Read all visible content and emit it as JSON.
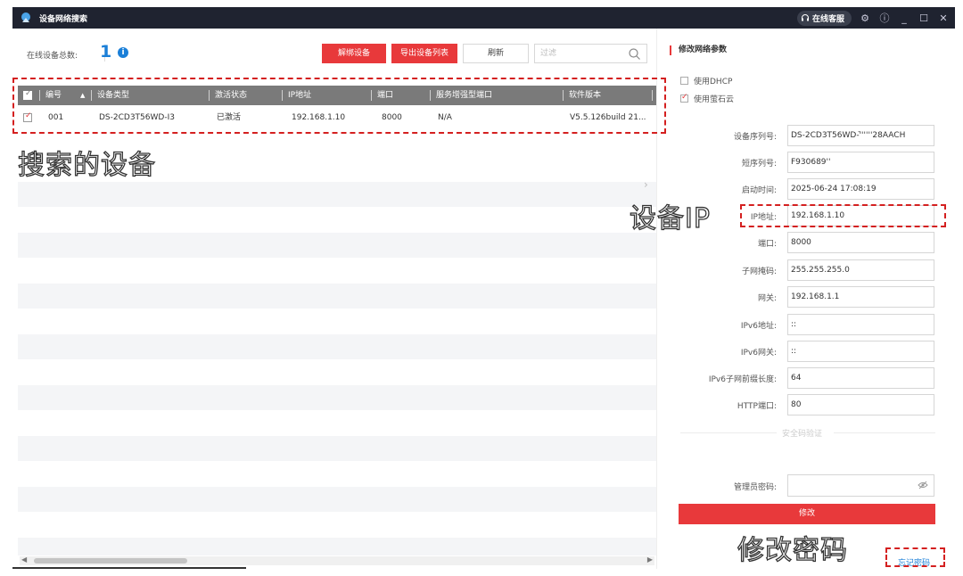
{
  "window": {
    "title": "设备网络搜索",
    "support_label": "在线客服",
    "controls": [
      "settings",
      "info",
      "minimize",
      "maximize",
      "close"
    ]
  },
  "toolbar": {
    "online_label": "在线设备总数:",
    "online_count": "1",
    "unbind_label": "解绑设备",
    "export_label": "导出设备列表",
    "refresh_label": "刷新",
    "filter_placeholder": "过滤"
  },
  "table": {
    "columns": [
      "编号",
      "设备类型",
      "激活状态",
      "IP地址",
      "端口",
      "服务增强型端口",
      "软件版本"
    ],
    "rows": [
      {
        "checked": true,
        "no": "001",
        "device_type": "DS-2CD3T56WD-I3",
        "status": "已激活",
        "ip": "192.168.1.10",
        "port": "8000",
        "enhanced_port": "N/A",
        "version": "V5.5.126build 21..."
      }
    ]
  },
  "panel": {
    "title": "修改网络参数",
    "options": [
      {
        "label": "使用DHCP",
        "checked": false
      },
      {
        "label": "使用萤石云",
        "checked": true
      }
    ],
    "fields": [
      {
        "label": "设备序列号:",
        "value": "DS-2CD3T56WD-'̄'''''28AACH"
      },
      {
        "label": "短序列号:",
        "value": "F930689''"
      },
      {
        "label": "启动时间:",
        "value": "2025-06-24 17:08:19"
      },
      {
        "label": "IP地址:",
        "value": "192.168.1.10"
      },
      {
        "label": "端口:",
        "value": "8000"
      },
      {
        "label": "子网掩码:",
        "value": "255.255.255.0"
      },
      {
        "label": "网关:",
        "value": "192.168.1.1"
      },
      {
        "label": "IPv6地址:",
        "value": "::"
      },
      {
        "label": "IPv6网关:",
        "value": "::"
      },
      {
        "label": "IPv6子网前缀长度:",
        "value": "64"
      },
      {
        "label": "HTTP端口:",
        "value": "80"
      }
    ],
    "security_divider": "安全码验证",
    "admin_password_label": "管理员密码:",
    "modify_label": "修改",
    "forgot_label": "忘记密码"
  },
  "annotations": {
    "searched_devices": "搜索的设备",
    "device_ip": "设备IP",
    "change_password": "修改密码"
  },
  "colors": {
    "accent_red": "#e8393b",
    "link_blue": "#1a7fd8",
    "titlebar": "#1f2330",
    "table_header": "#7a7a7a",
    "annotation_dash": "#d42020"
  }
}
